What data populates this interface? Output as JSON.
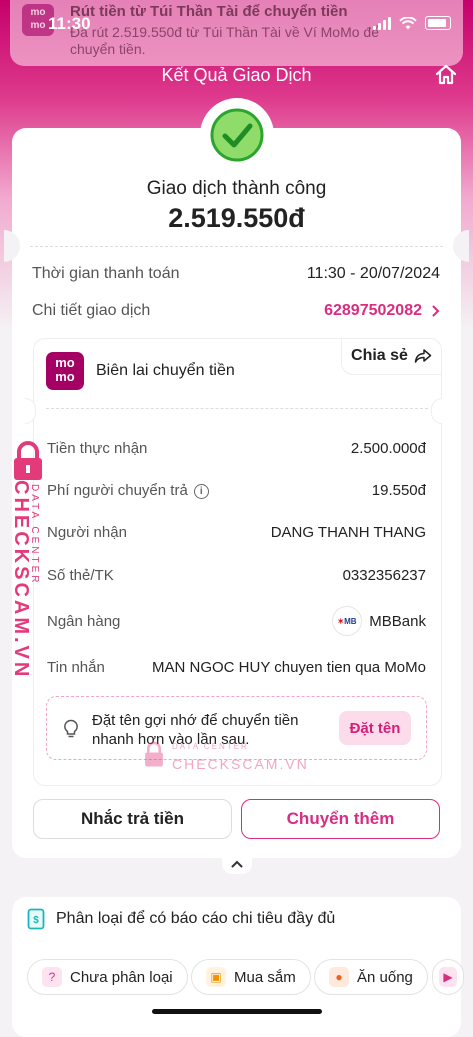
{
  "status_bar": {
    "time": "11:30"
  },
  "notification": {
    "app": "momo",
    "title": "Rút tiền từ Túi Thần Tài để chuyển tiền",
    "body": "Đã rút 2.519.550đ từ Túi Thần Tài về Ví MoMo để chuyển tiền."
  },
  "header": {
    "title": "Kết Quả Giao Dịch",
    "home_icon": "home-icon"
  },
  "result": {
    "status": "Giao dịch thành công",
    "amount": "2.519.550đ"
  },
  "summary": {
    "time_label": "Thời gian thanh toán",
    "time_value": "11:30 - 20/07/2024",
    "detail_label": "Chi tiết giao dịch",
    "detail_value": "62897502082"
  },
  "receipt": {
    "logo_top": "mo",
    "logo_bottom": "mo",
    "title": "Biên lai chuyển tiền",
    "share_label": "Chia sẻ",
    "rows": [
      {
        "label": "Tiền thực nhận",
        "value": "2.500.000đ"
      },
      {
        "label": "Phí người chuyển trả",
        "value": "19.550đ"
      },
      {
        "label": "Người nhận",
        "value": "DANG THANH THANG"
      },
      {
        "label": "Số thẻ/TK",
        "value": "0332356237"
      },
      {
        "label": "Ngân hàng",
        "value": "MBBank"
      },
      {
        "label": "Tin nhắn",
        "value": "MAN NGOC HUY chuyen tien qua MoMo"
      }
    ],
    "bank_logo_text": "MB",
    "tip_text": "Đặt tên gợi nhớ để chuyển tiền nhanh hơn vào lần sau.",
    "tip_button": "Đặt tên"
  },
  "actions": {
    "remind": "Nhắc trả tiền",
    "transfer_more": "Chuyển thêm"
  },
  "categorize": {
    "title": "Phân loại để có báo cáo chi tiêu đầy đủ",
    "chips": [
      "Chưa phân loại",
      "Mua sắm",
      "Ăn uống"
    ]
  },
  "watermark": {
    "brand": "CHECKSCAM.VN",
    "sub": "DATA CENTER"
  },
  "colors": {
    "brand": "#a50064",
    "accent": "#d82d82",
    "success": "#33c23a"
  }
}
